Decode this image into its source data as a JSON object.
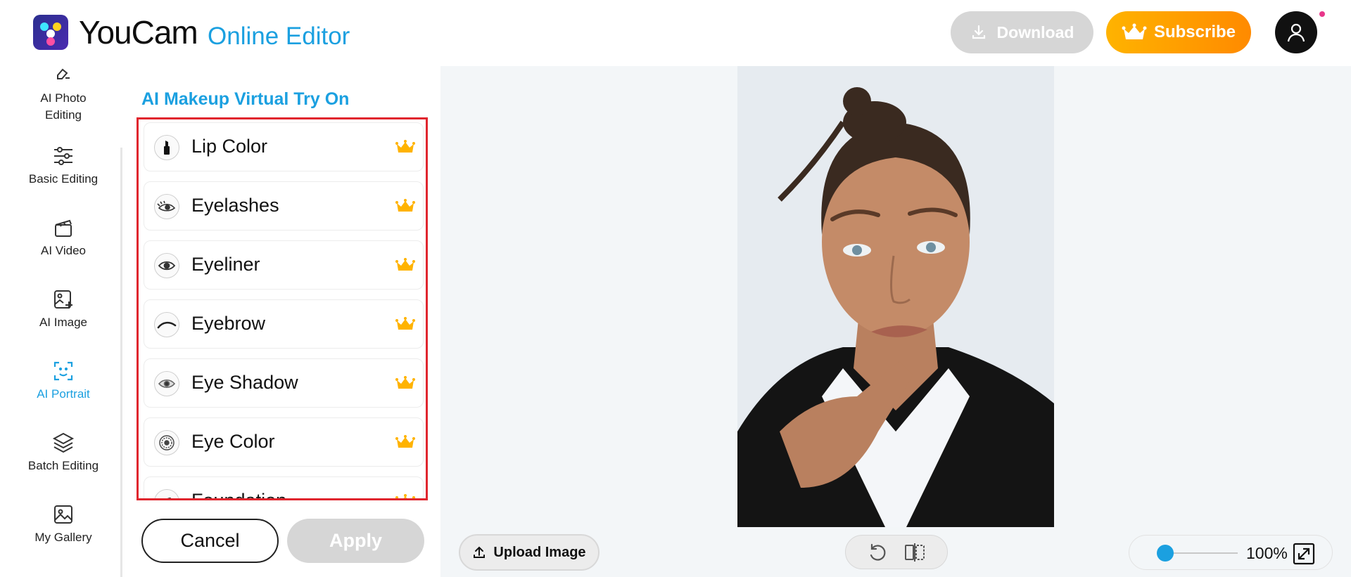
{
  "header": {
    "brand": "YouCam",
    "brand_sub": "Online Editor",
    "download_label": "Download",
    "subscribe_label": "Subscribe"
  },
  "nav": {
    "items": [
      {
        "label": "AI Photo Editing",
        "icon": "eraser-icon"
      },
      {
        "label": "Basic Editing",
        "icon": "sliders-icon"
      },
      {
        "label": "AI Video",
        "icon": "clapper-icon"
      },
      {
        "label": "AI Image",
        "icon": "image-sparkle-icon"
      },
      {
        "label": "AI Portrait",
        "icon": "face-scan-icon",
        "active": true
      },
      {
        "label": "Batch Editing",
        "icon": "layers-icon"
      },
      {
        "label": "My Gallery",
        "icon": "gallery-icon"
      }
    ]
  },
  "panel": {
    "title": "AI Makeup Virtual Try On",
    "items": [
      {
        "label": "Lip Color",
        "icon": "lipstick-icon",
        "premium": true
      },
      {
        "label": "Eyelashes",
        "icon": "eyelash-icon",
        "premium": true
      },
      {
        "label": "Eyeliner",
        "icon": "eye-icon",
        "premium": true
      },
      {
        "label": "Eyebrow",
        "icon": "eyebrow-icon",
        "premium": true
      },
      {
        "label": "Eye Shadow",
        "icon": "eye-shadow-icon",
        "premium": true
      },
      {
        "label": "Eye Color",
        "icon": "iris-icon",
        "premium": true
      },
      {
        "label": "Foundation",
        "icon": "foundation-icon",
        "premium": true
      }
    ],
    "cancel_label": "Cancel",
    "apply_label": "Apply"
  },
  "canvas": {
    "upload_label": "Upload Image",
    "zoom_label": "100%",
    "zoom_level": 0.1
  },
  "colors": {
    "accent": "#1ba0e0",
    "subscribe": "#ff9f00",
    "highlight_frame": "#e0262e"
  }
}
